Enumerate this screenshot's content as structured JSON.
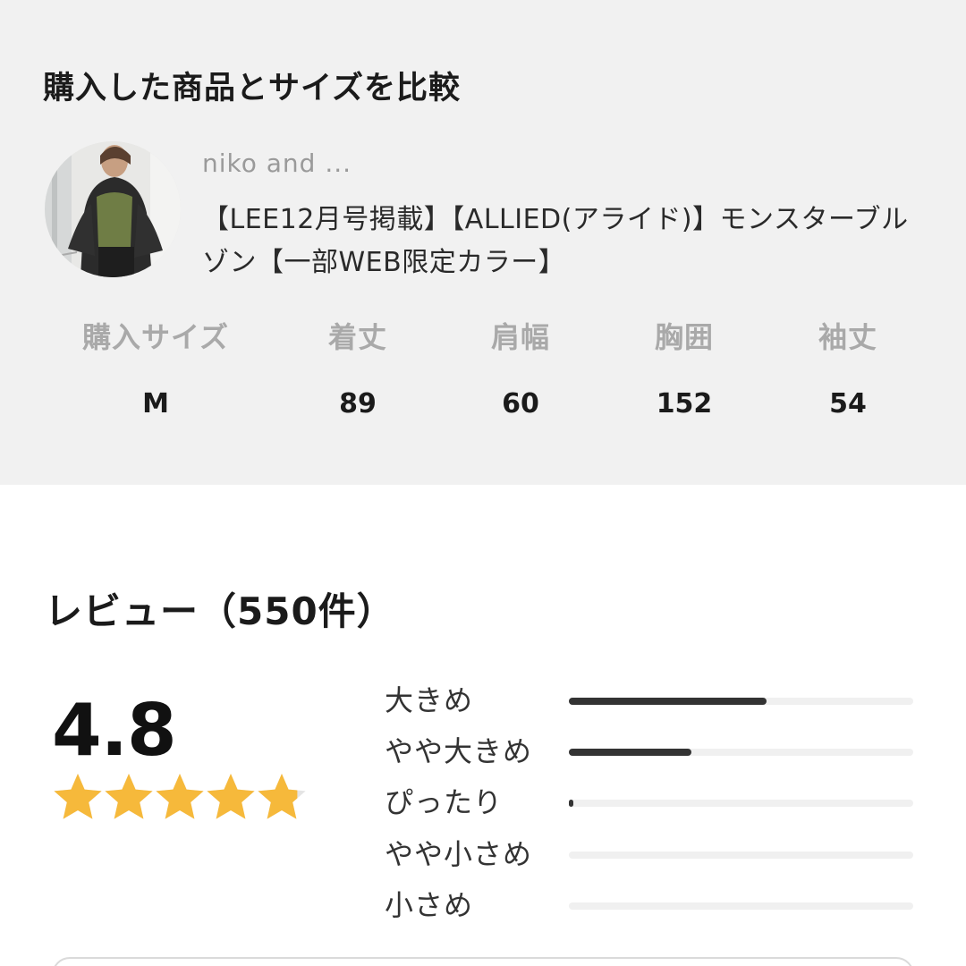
{
  "compare": {
    "title": "購入した商品とサイズを比較",
    "brand": "niko and ...",
    "product_name": "【LEE12月号掲載】【ALLIED(アライド)】モンスターブルゾン【一部WEB限定カラー】",
    "size_headers": [
      "購入サイズ",
      "着丈",
      "肩幅",
      "胸囲",
      "袖丈"
    ],
    "size_values": [
      "M",
      "89",
      "60",
      "152",
      "54"
    ]
  },
  "review": {
    "title": "レビュー（550件）",
    "score": "4.8",
    "rating": 4.8,
    "star_color": "#f6b93b",
    "star_empty_color": "#e4e4e4",
    "fit_bars": [
      {
        "label": "大きめ",
        "fraction": 0.575
      },
      {
        "label": "やや大きめ",
        "fraction": 0.355
      },
      {
        "label": "ぴったり",
        "fraction": 0.012
      },
      {
        "label": "やや小さめ",
        "fraction": 0
      },
      {
        "label": "小さめ",
        "fraction": 0
      }
    ]
  }
}
